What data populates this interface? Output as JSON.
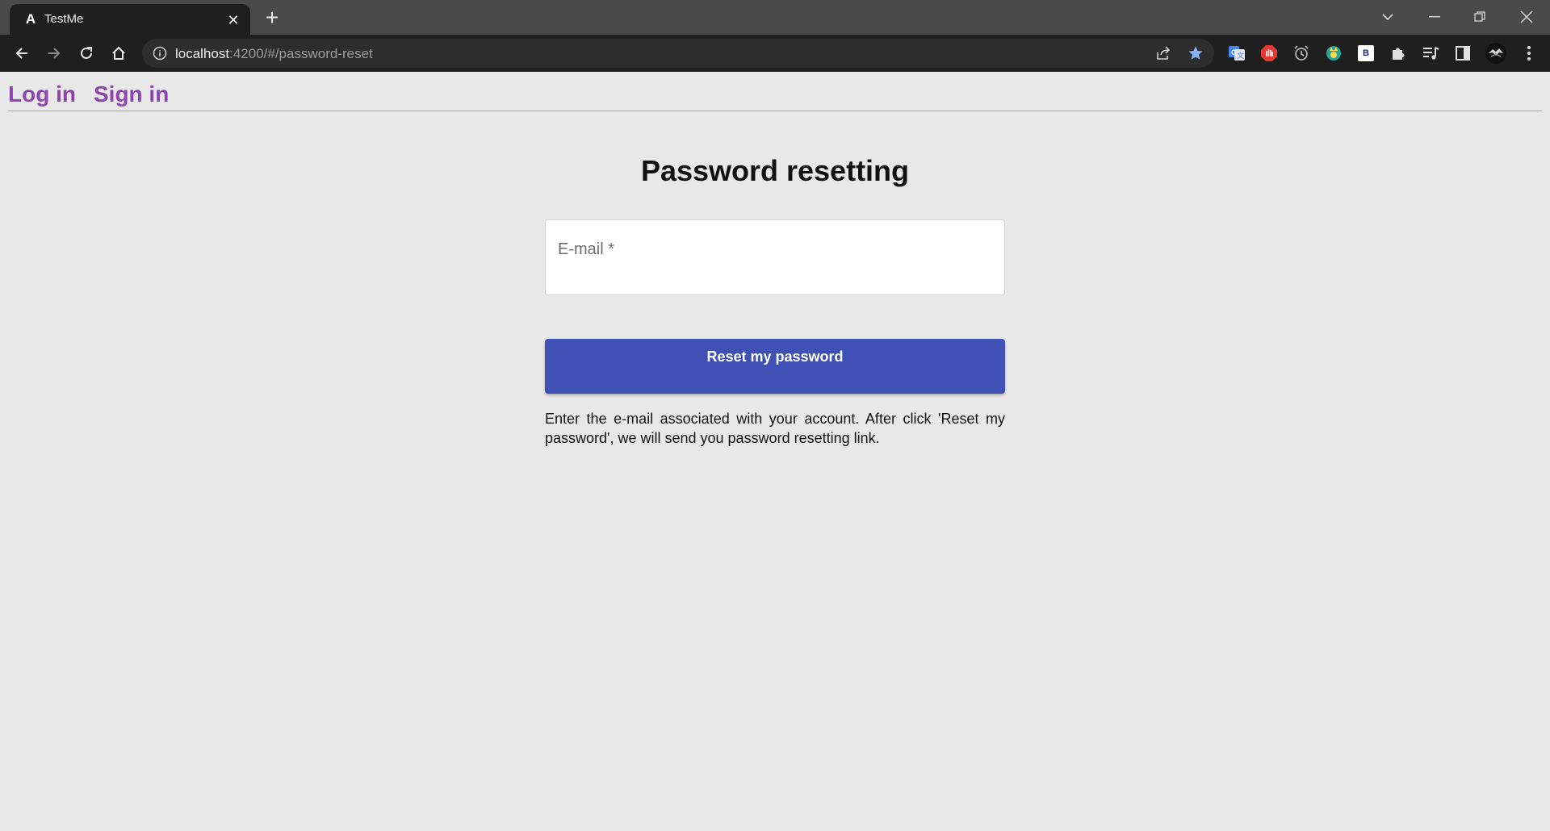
{
  "browser": {
    "tab": {
      "title": "TestMe",
      "favicon": "A"
    },
    "url": {
      "host": "localhost",
      "rest": ":4200/#/password-reset"
    },
    "colors": {
      "tabstrip": "#4a4a4a",
      "toolbar": "#1f1f1f",
      "bookmark_star": "#8ab4f8"
    },
    "extensions": [
      "google-translate-icon",
      "adblock-icon",
      "alarm-clock-icon",
      "cat-extension-icon",
      "b-extension-icon",
      "puzzle-icon",
      "media-control-icon",
      "side-panel-icon",
      "profile-avatar"
    ],
    "extension_b_label": "B"
  },
  "nav": {
    "login": "Log in",
    "signin": "Sign in",
    "link_color": "#8e44ad"
  },
  "main": {
    "title": "Password resetting",
    "email_label": "E-mail *",
    "email_value": "",
    "reset_button": "Reset my password",
    "help_text": "Enter the e-mail associated with your account. After click 'Reset my password', we will send you password resetting link.",
    "button_color": "#3f51b5"
  }
}
